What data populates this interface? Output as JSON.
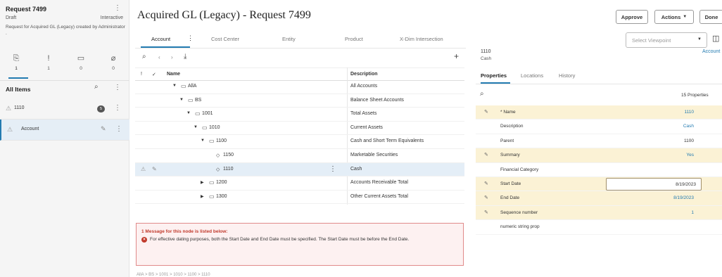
{
  "request": {
    "title": "Request 7499",
    "status": "Draft",
    "mode": "Interactive",
    "description": "Request for Acquired GL (Legacy) created by Administrator ."
  },
  "left_tabs": [
    {
      "icon": "request-items-icon",
      "glyph": "⎘",
      "count": "1"
    },
    {
      "icon": "warning-icon",
      "glyph": "!",
      "count": "1"
    },
    {
      "icon": "comment-icon",
      "glyph": "▭",
      "count": "0"
    },
    {
      "icon": "attachment-icon",
      "glyph": "⌀",
      "count": "0"
    }
  ],
  "all_items": {
    "label": "All Items",
    "rows": [
      {
        "label": "1110",
        "badge": "5"
      },
      {
        "label": "Account"
      }
    ]
  },
  "header": {
    "title": "Acquired GL (Legacy) - Request 7499",
    "approve": "Approve",
    "actions": "Actions",
    "done": "Done"
  },
  "tabs": [
    "Account",
    "Cost Center",
    "Entity",
    "Product",
    "X-Dim Intersection"
  ],
  "viewpoint": {
    "placeholder": "Select Viewpoint"
  },
  "grid": {
    "columns": {
      "name": "Name",
      "description": "Description"
    },
    "rows": [
      {
        "name": "AllA",
        "description": "All Accounts",
        "level": 0,
        "type": "folder",
        "expanded": true
      },
      {
        "name": "BS",
        "description": "Balance Sheet Accounts",
        "level": 1,
        "type": "folder",
        "expanded": true
      },
      {
        "name": "1001",
        "description": "Total Assets",
        "level": 2,
        "type": "folder",
        "expanded": true
      },
      {
        "name": "1010",
        "description": "Current Assets",
        "level": 3,
        "type": "folder",
        "expanded": true
      },
      {
        "name": "1100",
        "description": "Cash and Short Term Equivalents",
        "level": 4,
        "type": "folder",
        "expanded": true
      },
      {
        "name": "1150",
        "description": "Marketable Securities",
        "level": 5,
        "type": "leaf"
      },
      {
        "name": "1110",
        "description": "Cash",
        "level": 5,
        "type": "leaf",
        "selected": true
      },
      {
        "name": "1200",
        "description": "Accounts Receivable Total",
        "level": 4,
        "type": "folder",
        "expanded": false
      },
      {
        "name": "1300",
        "description": "Other Current Assets Total",
        "level": 4,
        "type": "folder",
        "expanded": false
      }
    ]
  },
  "message": {
    "title": "1 Message for this node is listed below:",
    "text": "For effective dating purposes, both the Start Date and End Date must be specified. The Start Date must be before the End Date."
  },
  "breadcrumb": "AllA > BS > 1001 > 1010 > 1100 > 1110",
  "node": {
    "code": "1110",
    "name": "Cash",
    "link": "Account"
  },
  "right_tabs": [
    "Properties",
    "Locations",
    "History"
  ],
  "properties_count": "15 Properties",
  "properties": [
    {
      "label": "* Name",
      "value": "1110",
      "edited": true,
      "highlight": true
    },
    {
      "label": "Description",
      "value": "Cash",
      "edited": false,
      "highlight": false
    },
    {
      "label": "Parent",
      "value": "1100",
      "edited": false,
      "highlight": false,
      "dark": true
    },
    {
      "label": "Summary",
      "value": "Yes",
      "edited": true,
      "highlight": true
    },
    {
      "label": "Financial Category",
      "value": "",
      "edited": false,
      "highlight": false
    },
    {
      "label": "Start Date",
      "value": "8/19/2023",
      "edited": true,
      "highlight": true,
      "boxed": true
    },
    {
      "label": "End Date",
      "value": "8/19/2023",
      "edited": true,
      "highlight": true
    },
    {
      "label": "Sequence number",
      "value": "1",
      "edited": true,
      "highlight": true
    },
    {
      "label": "numeric string prop",
      "value": "",
      "edited": false,
      "highlight": false
    }
  ],
  "colors": {
    "accent": "#237bb1",
    "highlight": "#fbf2d5",
    "error": "#c0392b",
    "selected": "#e4eef7"
  }
}
